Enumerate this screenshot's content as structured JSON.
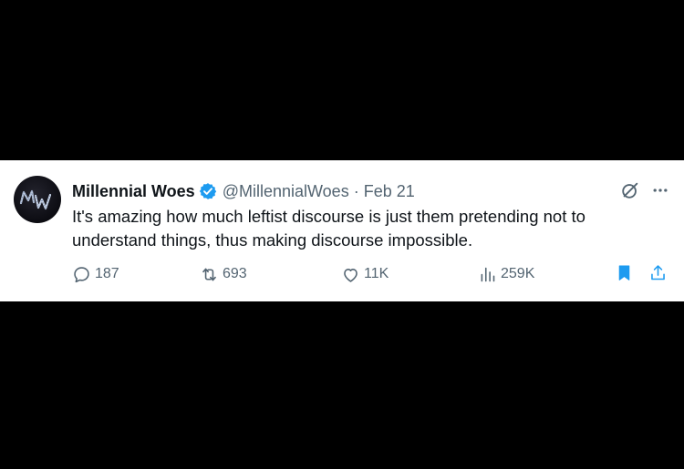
{
  "tweet": {
    "author": {
      "display_name": "Millennial Woes",
      "handle": "@MillennialWoes",
      "avatar_monogram": "MW",
      "verified": true
    },
    "separator": "·",
    "date": "Feb 21",
    "text": "It's amazing how much leftist discourse is just them pretending not to understand things, thus making discourse impossible.",
    "actions": {
      "replies": "187",
      "retweets": "693",
      "likes": "11K",
      "views": "259K"
    }
  },
  "icons": {
    "reply": "reply-icon",
    "retweet": "retweet-icon",
    "like": "heart-icon",
    "views": "analytics-icon",
    "bookmark": "bookmark-icon",
    "share": "share-icon",
    "grok": "grok-icon",
    "more": "more-icon",
    "verified": "verified-badge-icon"
  },
  "colors": {
    "text_primary": "#0f1419",
    "text_secondary": "#536471",
    "verified_blue": "#1d9bf0",
    "bookmark_blue": "#1d9bf0",
    "background": "#ffffff",
    "letterbox": "#000000"
  }
}
